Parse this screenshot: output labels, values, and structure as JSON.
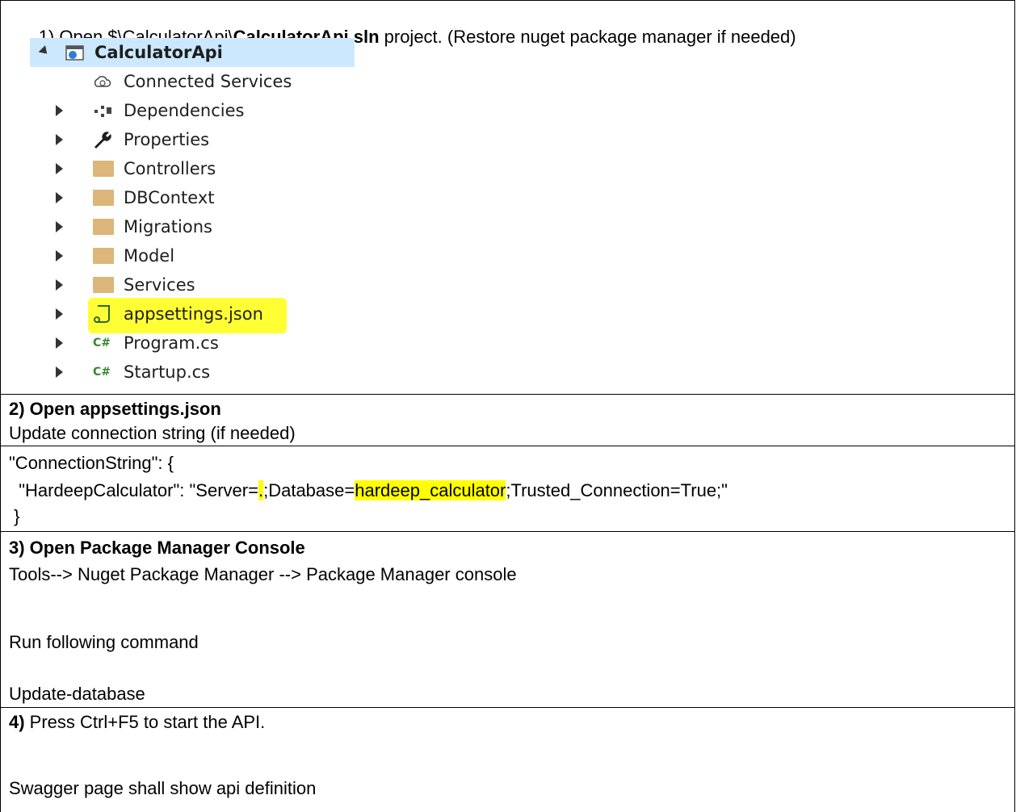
{
  "step1": {
    "prefix": "1) Open $\\CalculatorApi\\",
    "bold_file": "CalculatorApi.sln",
    "suffix": " project. (Restore nuget package manager if needed)"
  },
  "solution_explorer": {
    "root": "CalculatorApi",
    "items": [
      {
        "label": "Connected Services",
        "icon": "cloud-globe-icon",
        "expandable": false
      },
      {
        "label": "Dependencies",
        "icon": "dependencies-icon",
        "expandable": true
      },
      {
        "label": "Properties",
        "icon": "wrench-icon",
        "expandable": true
      },
      {
        "label": "Controllers",
        "icon": "folder-icon",
        "expandable": true
      },
      {
        "label": "DBContext",
        "icon": "folder-icon",
        "expandable": true
      },
      {
        "label": "Migrations",
        "icon": "folder-icon",
        "expandable": true
      },
      {
        "label": "Model",
        "icon": "folder-icon",
        "expandable": true
      },
      {
        "label": "Services",
        "icon": "folder-icon",
        "expandable": true
      },
      {
        "label": "appsettings.json",
        "icon": "json-file-icon",
        "expandable": true
      },
      {
        "label": "Program.cs",
        "icon": "csharp-file-icon",
        "expandable": true
      },
      {
        "label": "Startup.cs",
        "icon": "csharp-file-icon",
        "expandable": true
      }
    ],
    "cs_glyph": "C#",
    "highlight_color": "#ffff33",
    "selection_color": "#cce8ff"
  },
  "step2": {
    "title": "2) Open appsettings.json",
    "desc": "Update connection string (if needed)"
  },
  "code": {
    "line1": "\"ConnectionString\": {",
    "line2_a": "  \"HardeepCalculator\": \"Server=",
    "line2_hl1": ".",
    "line2_b": ";Database=",
    "line2_hl2": "hardeep_calculator",
    "line2_c": ";Trusted_Connection=True;\"",
    "line3": " }"
  },
  "step3": {
    "title": "3) Open Package Manager Console",
    "path": "Tools--> Nuget Package Manager --> Package Manager console",
    "run": "Run following command",
    "command": "Update-database"
  },
  "step4": {
    "num": "4)",
    "text": " Press Ctrl+F5 to start the API.",
    "result": "Swagger page shall show api definition"
  },
  "colors": {
    "highlight": "#ffff00"
  }
}
